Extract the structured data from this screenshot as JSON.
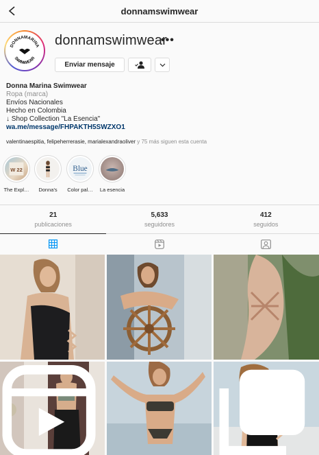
{
  "topbar": {
    "title": "donnamswimwear"
  },
  "profile": {
    "username": "donnamswimwear",
    "more_label": "•••",
    "message_button": "Enviar mensaje",
    "avatar_text": "DONNAMARINA SWIMWEAR",
    "avatar_logo_top": "DONNAMARINA",
    "avatar_logo_bottom": "SWIMWEAR"
  },
  "bio": {
    "name": "Donna Marina Swimwear",
    "category": "Ropa (marca)",
    "line1": "Envíos Nacionales",
    "line2": "Hecho en Colombia",
    "line3": "↓ Shop Collection \"La Esencia\"",
    "link": "wa.me/message/FHPAKTH5SWZXO1"
  },
  "followed_by": {
    "names": "valentinaespitia, felipeherrerasie, marialexandraoliver",
    "rest": " y 75 más siguen esta cuenta"
  },
  "highlights": [
    {
      "label": "The Expl…",
      "icon_text": "W 22"
    },
    {
      "label": "Donna's"
    },
    {
      "label": "Color pal…",
      "icon_text": "Blue"
    },
    {
      "label": "La esencia"
    }
  ],
  "stats": [
    {
      "value": "21",
      "label": "publicaciones"
    },
    {
      "value": "5,633",
      "label": "seguidores"
    },
    {
      "value": "412",
      "label": "seguidos"
    }
  ],
  "tabs": [
    {
      "icon": "grid-icon",
      "active": true
    },
    {
      "icon": "reels-icon",
      "active": false
    },
    {
      "icon": "tagged-icon",
      "active": false
    }
  ],
  "colors": {
    "text": "#262626",
    "secondary": "#8e8e8e",
    "link": "#00376b",
    "border": "#dbdbdb",
    "background": "#fafafa"
  }
}
